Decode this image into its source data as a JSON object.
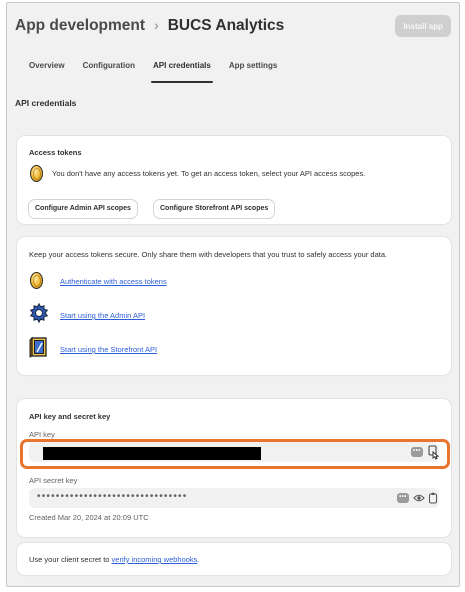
{
  "header": {
    "breadcrumb_parent": "App development",
    "breadcrumb_separator": "›",
    "breadcrumb_current": "BUCS Analytics",
    "install_button": "Install app"
  },
  "tabs": [
    {
      "label": "Overview",
      "active": false
    },
    {
      "label": "Configuration",
      "active": false
    },
    {
      "label": "API credentials",
      "active": true
    },
    {
      "label": "App settings",
      "active": false
    }
  ],
  "section_title": "API credentials",
  "access_tokens": {
    "title": "Access tokens",
    "message": "You don't have any access tokens yet. To get an access token, select your API access scopes.",
    "button_admin": "Configure Admin API scopes",
    "button_storefront": "Configure Storefront API scopes"
  },
  "security_card": {
    "message": "Keep your access tokens secure. Only share them with developers that you trust to safely access your data.",
    "links": [
      {
        "label": "Authenticate with access tokens",
        "icon": "coin-icon"
      },
      {
        "label": "Start using the Admin API",
        "icon": "gear-icon"
      },
      {
        "label": "Start using the Storefront API",
        "icon": "storefront-book-icon"
      }
    ]
  },
  "api_keys": {
    "title": "API key and secret key",
    "api_key_label": "API key",
    "api_secret_label": "API secret key",
    "secret_masked": "••••••••••••••••••••••••••••••••",
    "badge_text": "•••",
    "created": "Created Mar 20, 2024 at 20:09 UTC"
  },
  "webhooks": {
    "prefix": "Use your client secret to ",
    "link": "verify incoming webhooks",
    "suffix": "."
  },
  "colors": {
    "highlight": "#e8752e",
    "link": "#2c5fd6",
    "background": "#f1f1f1"
  }
}
